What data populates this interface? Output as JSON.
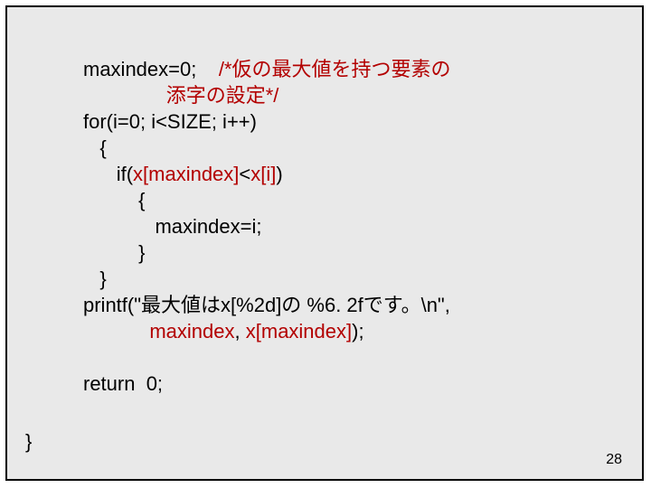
{
  "code": {
    "l1a": "maxindex=0;",
    "l1b": "/*仮の最大値を持つ要素の",
    "l2": "添字の設定*/",
    "l3": "for(i=0; i<SIZE; i++)",
    "l4": "{",
    "l5a": "if(",
    "l5b": "x[maxindex]",
    "l5c": "<",
    "l5d": "x[i]",
    "l5e": ")",
    "l6": "{",
    "l7": "maxindex=i;",
    "l8": "}",
    "l9": "}",
    "l10": "printf(\"最大値はx[%2d]の %6. 2fです。\\n\",",
    "l11a": "maxindex",
    "l11b": ", ",
    "l11c": "x[maxindex]",
    "l11d": ");",
    "l12": "return  0;",
    "l13": "}"
  },
  "page_number": "28"
}
